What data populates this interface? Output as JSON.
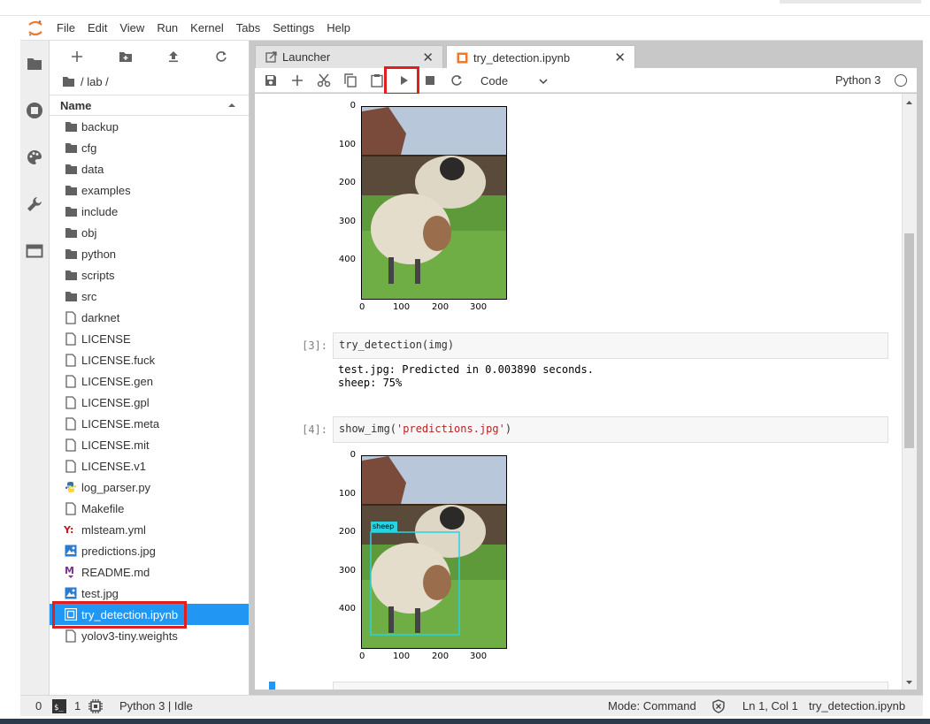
{
  "menu": [
    "File",
    "Edit",
    "View",
    "Run",
    "Kernel",
    "Tabs",
    "Settings",
    "Help"
  ],
  "file_browser": {
    "breadcrumb": "/ lab /",
    "column_header": "Name",
    "items": [
      {
        "name": "backup",
        "type": "folder"
      },
      {
        "name": "cfg",
        "type": "folder"
      },
      {
        "name": "data",
        "type": "folder"
      },
      {
        "name": "examples",
        "type": "folder"
      },
      {
        "name": "include",
        "type": "folder"
      },
      {
        "name": "obj",
        "type": "folder"
      },
      {
        "name": "python",
        "type": "folder"
      },
      {
        "name": "scripts",
        "type": "folder"
      },
      {
        "name": "src",
        "type": "folder"
      },
      {
        "name": "darknet",
        "type": "file"
      },
      {
        "name": "LICENSE",
        "type": "file"
      },
      {
        "name": "LICENSE.fuck",
        "type": "file"
      },
      {
        "name": "LICENSE.gen",
        "type": "file"
      },
      {
        "name": "LICENSE.gpl",
        "type": "file"
      },
      {
        "name": "LICENSE.meta",
        "type": "file"
      },
      {
        "name": "LICENSE.mit",
        "type": "file"
      },
      {
        "name": "LICENSE.v1",
        "type": "file"
      },
      {
        "name": "log_parser.py",
        "type": "python"
      },
      {
        "name": "Makefile",
        "type": "file"
      },
      {
        "name": "mlsteam.yml",
        "type": "yaml"
      },
      {
        "name": "predictions.jpg",
        "type": "image"
      },
      {
        "name": "README.md",
        "type": "markdown"
      },
      {
        "name": "test.jpg",
        "type": "image"
      },
      {
        "name": "try_detection.ipynb",
        "type": "notebook",
        "selected": true
      },
      {
        "name": "yolov3-tiny.weights",
        "type": "file"
      }
    ]
  },
  "tabs": [
    {
      "label": "Launcher",
      "active": false
    },
    {
      "label": "try_detection.ipynb",
      "active": true
    }
  ],
  "toolbar": {
    "cell_type": "Code",
    "kernel_name": "Python 3"
  },
  "cells": [
    {
      "prompt": "[3]:",
      "code": "try_detection(img)",
      "output": "test.jpg: Predicted in 0.003890 seconds.\nsheep: 75%"
    },
    {
      "prompt": "[4]:",
      "code_fn": "show_img(",
      "code_str": "'predictions.jpg'",
      "code_end": ")"
    }
  ],
  "plot": {
    "y_ticks": [
      "0",
      "100",
      "200",
      "300",
      "400"
    ],
    "x_ticks": [
      "0",
      "100",
      "200",
      "300"
    ],
    "detection_label": "sheep"
  },
  "status": {
    "terminals": "0",
    "kernels": "1",
    "kernel_state": "Python 3 | Idle",
    "mode": "Mode: Command",
    "cursor": "Ln 1, Col 1",
    "filename": "try_detection.ipynb"
  },
  "colors": {
    "accent": "#2196f3",
    "highlight": "#e02020",
    "jupyter_orange": "#f37726",
    "bbox": "#27d3e3"
  }
}
